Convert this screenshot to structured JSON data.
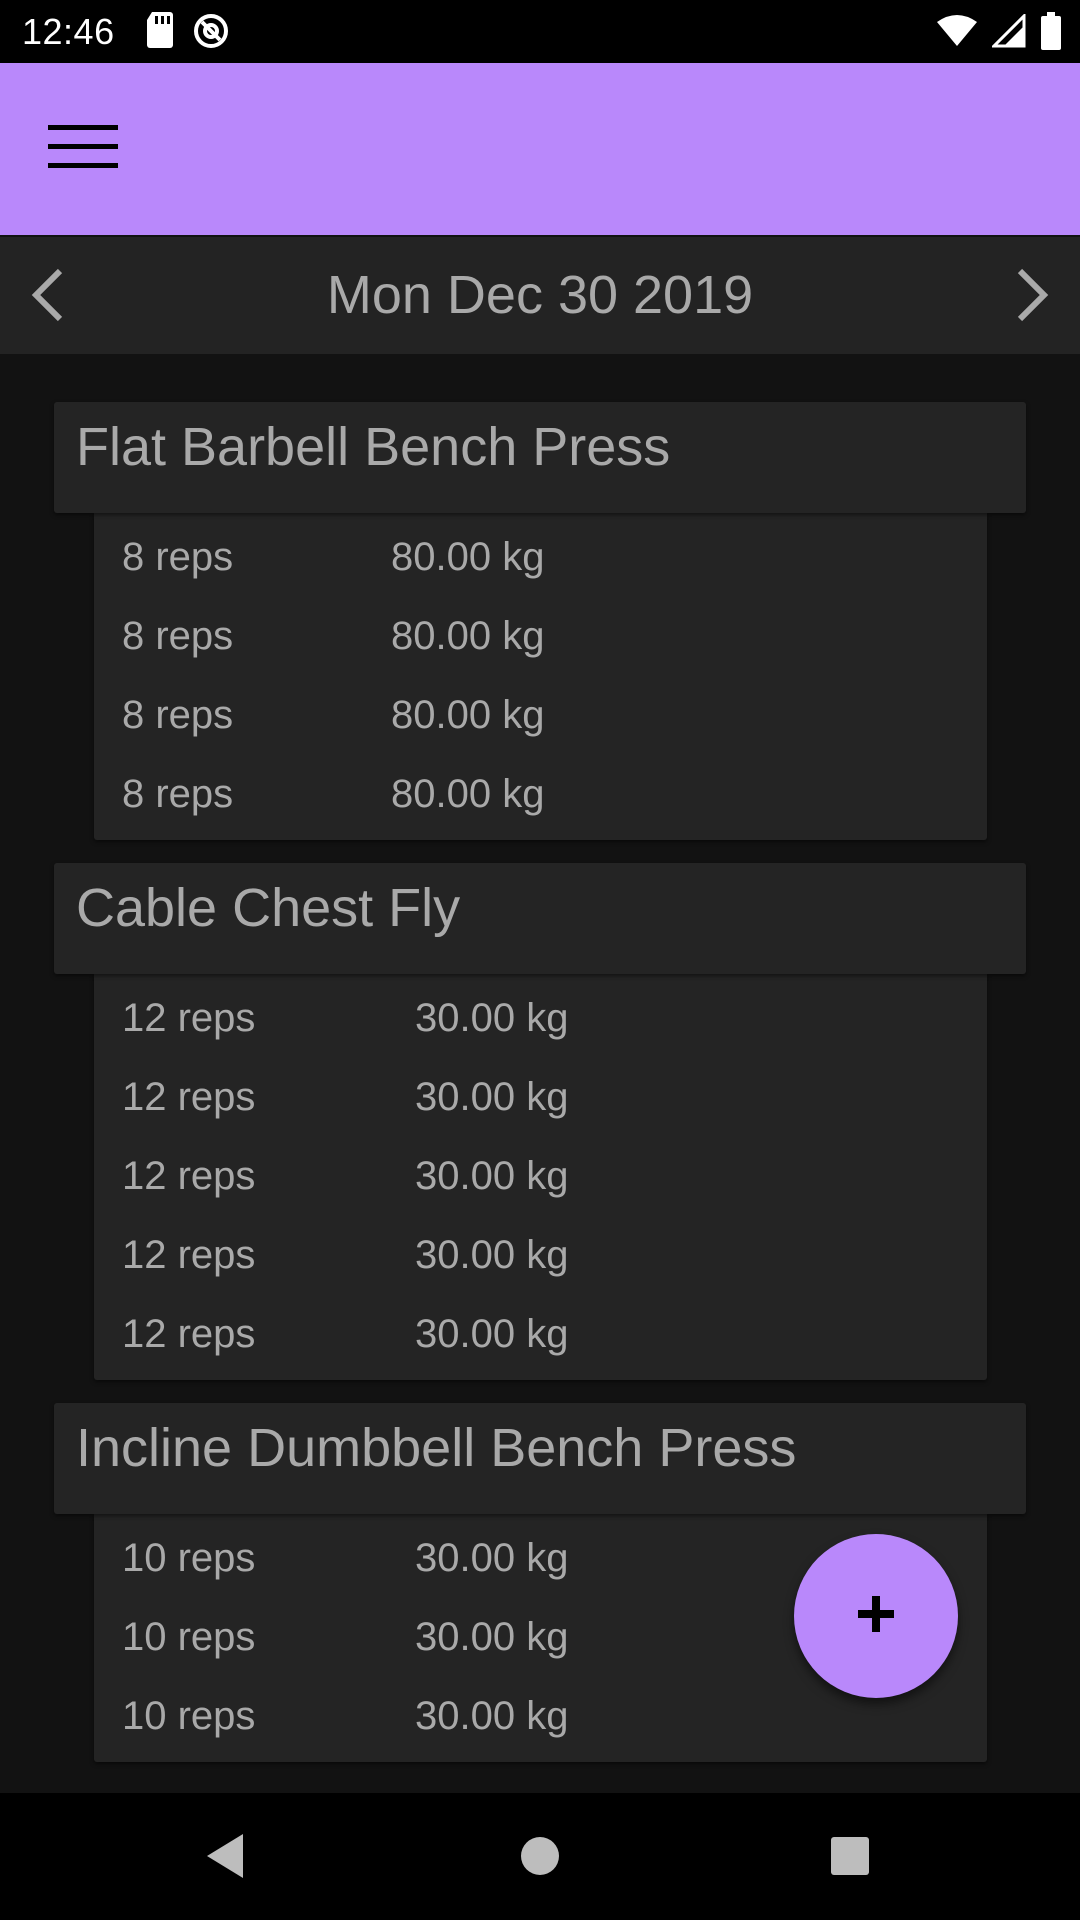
{
  "status_bar": {
    "time": "12:46",
    "icons": [
      "sd-card-icon",
      "at-sign-icon",
      "wifi-icon",
      "signal-icon",
      "battery-icon"
    ]
  },
  "app_bar": {
    "menu_icon": "hamburger-menu-icon",
    "color": "#b988fb"
  },
  "date_nav": {
    "date": "Mon Dec 30 2019",
    "prev_icon": "chevron-left-icon",
    "next_icon": "chevron-right-icon"
  },
  "exercises": [
    {
      "name": "Flat Barbell Bench Press",
      "sets": [
        {
          "reps": "8 reps",
          "weight": "80.00 kg"
        },
        {
          "reps": "8 reps",
          "weight": "80.00 kg"
        },
        {
          "reps": "8 reps",
          "weight": "80.00 kg"
        },
        {
          "reps": "8 reps",
          "weight": "80.00 kg"
        }
      ]
    },
    {
      "name": "Cable Chest Fly",
      "sets": [
        {
          "reps": "12 reps",
          "weight": "30.00 kg"
        },
        {
          "reps": "12 reps",
          "weight": "30.00 kg"
        },
        {
          "reps": "12 reps",
          "weight": "30.00 kg"
        },
        {
          "reps": "12 reps",
          "weight": "30.00 kg"
        },
        {
          "reps": "12 reps",
          "weight": "30.00 kg"
        }
      ]
    },
    {
      "name": "Incline Dumbbell Bench Press",
      "sets": [
        {
          "reps": "10 reps",
          "weight": "30.00 kg"
        },
        {
          "reps": "10 reps",
          "weight": "30.00 kg"
        },
        {
          "reps": "10 reps",
          "weight": "30.00 kg"
        }
      ]
    }
  ],
  "fab": {
    "icon": "plus-icon"
  },
  "nav_bar": {
    "icons": [
      "back-triangle-icon",
      "home-circle-icon",
      "recents-square-icon"
    ]
  }
}
